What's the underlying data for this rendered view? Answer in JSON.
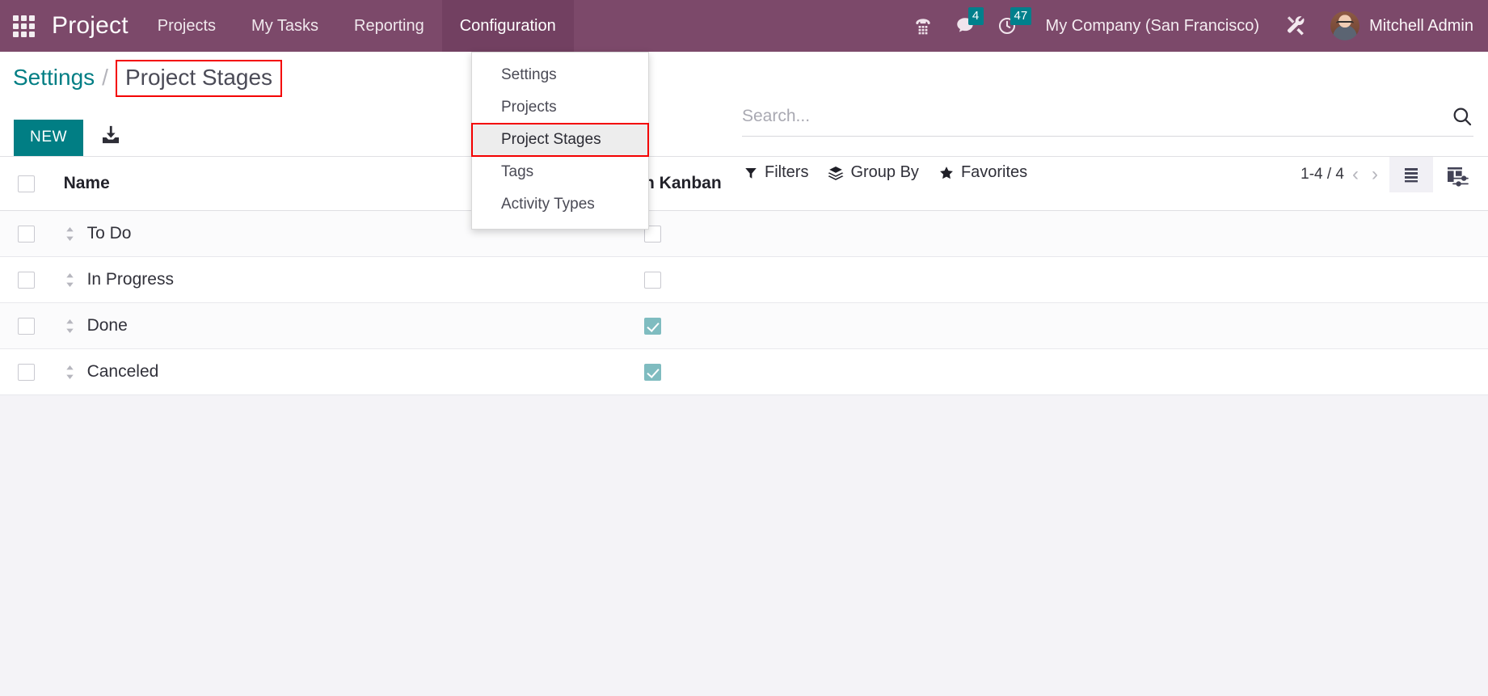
{
  "navbar": {
    "apps_icon": "apps-grid-icon",
    "brand": "Project",
    "menus": [
      {
        "label": "Projects",
        "active": false
      },
      {
        "label": "My Tasks",
        "active": false
      },
      {
        "label": "Reporting",
        "active": false
      },
      {
        "label": "Configuration",
        "active": true
      }
    ],
    "phone_icon": "dialpad-phone-icon",
    "messages": {
      "icon": "chat-bubble-icon",
      "count": "4"
    },
    "activities": {
      "icon": "clock-icon",
      "count": "47"
    },
    "company": "My Company (San Francisco)",
    "settings_icon": "wrench-screwdriver-icon",
    "user_name": "Mitchell Admin",
    "accent": "#7c496a",
    "badge_color": "#00808c"
  },
  "dropdown": {
    "items": [
      {
        "label": "Settings",
        "highlighted": false
      },
      {
        "label": "Projects",
        "highlighted": false
      },
      {
        "label": "Project Stages",
        "highlighted": true
      },
      {
        "label": "Tags",
        "highlighted": false
      },
      {
        "label": "Activity Types",
        "highlighted": false
      }
    ],
    "highlight_outline": "#f40000"
  },
  "breadcrumb": {
    "root": "Settings",
    "separator": "/",
    "current": "Project Stages",
    "current_outline": "#f40000"
  },
  "toolbar": {
    "new_label": "NEW",
    "new_color": "#017e84",
    "download_icon": "download-icon"
  },
  "search": {
    "placeholder": "Search...",
    "value": "",
    "icon": "search-icon"
  },
  "filters": [
    {
      "label": "Filters",
      "icon": "funnel-icon"
    },
    {
      "label": "Group By",
      "icon": "layers-icon"
    },
    {
      "label": "Favorites",
      "icon": "star-icon"
    }
  ],
  "pager": {
    "range": "1-4 / 4",
    "prev_icon": "chevron-left-icon",
    "next_icon": "chevron-right-icon"
  },
  "views": [
    {
      "name": "list",
      "icon": "list-view-icon",
      "active": true
    },
    {
      "name": "kanban",
      "icon": "kanban-view-icon",
      "active": false
    }
  ],
  "table": {
    "columns": [
      {
        "key": "select",
        "label": ""
      },
      {
        "key": "name",
        "label": "Name"
      },
      {
        "key": "folded",
        "label": "n Kanban"
      },
      {
        "key": "options",
        "label": ""
      }
    ],
    "optional_columns_icon": "sliders-icon",
    "rows": [
      {
        "selected": false,
        "name": "To Do",
        "folded": false
      },
      {
        "selected": false,
        "name": "In Progress",
        "folded": false
      },
      {
        "selected": false,
        "name": "Done",
        "folded": true
      },
      {
        "selected": false,
        "name": "Canceled",
        "folded": true
      }
    ],
    "checked_color": "#7fbcc0"
  }
}
